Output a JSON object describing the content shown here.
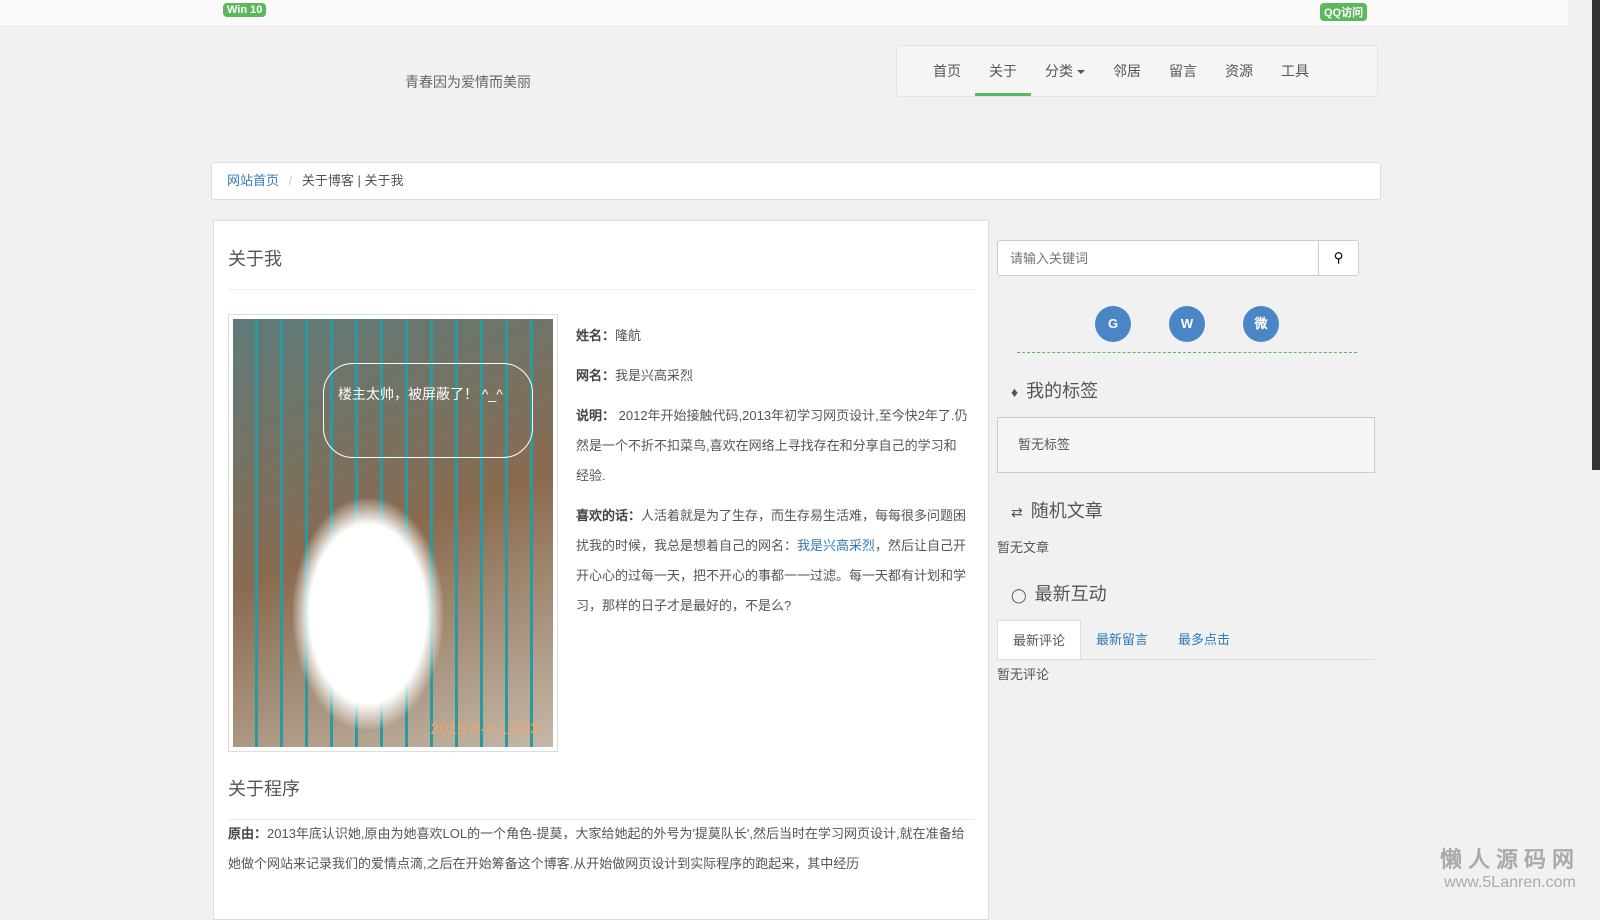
{
  "topbar": {
    "left_badge": "Win 10",
    "right_badge": "QQ访问"
  },
  "header": {
    "slogan": "青春因为爱情而美丽"
  },
  "nav": [
    {
      "label": "首页"
    },
    {
      "label": "关于"
    },
    {
      "label": "分类"
    },
    {
      "label": "邻居"
    },
    {
      "label": "留言"
    },
    {
      "label": "资源"
    },
    {
      "label": "工具"
    }
  ],
  "breadcrumb": {
    "home": "网站首页",
    "sep": "/",
    "current": "关于博客 | 关于我"
  },
  "main": {
    "title": "关于我",
    "photo": {
      "caption": "楼主太帅，被屏蔽了！ ^_^",
      "timestamp": "2015-5-4 10:03"
    },
    "name_label": "姓名：",
    "name": "隆航",
    "nick_label": "网名：",
    "nick": "我是兴高采烈",
    "desc_label": "说明：",
    "desc": " 2012年开始接触代码,2013年初学习网页设计,至今快2年了.仍然是一个不折不扣菜鸟,喜欢在网络上寻找存在和分享自己的学习和经验.",
    "quote_label": "喜欢的话：",
    "quote_a": "人活着就是为了生存，而生存易生活难，每每很多问题困扰我的时候，我总是想着自己的网名：",
    "quote_link": "我是兴高采烈",
    "quote_b": "，然后让自己开开心心的过每一天，把不开心的事都一一过滤。每一天都有计划和学习，那样的日子才是最好的，不是么?",
    "program_title": "关于程序",
    "reason_label": "原由：",
    "reason": "2013年底认识她,原由为她喜欢LOL的一个角色-提莫，大家给她起的外号为'提莫队长',然后当时在学习网页设计,就在准备给她做个网站来记录我们的爱情点滴,之后在开始筹备这个博客.从开始做网页设计到实际程序的跑起来，其中经历"
  },
  "sidebar": {
    "search_placeholder": "请输入关键词",
    "social": [
      {
        "icon": "github-icon",
        "glyph": "G"
      },
      {
        "icon": "wechat-icon",
        "glyph": "W"
      },
      {
        "icon": "weibo-icon",
        "glyph": "微"
      }
    ],
    "tags_title": "我的标签",
    "tags_empty": "暂无标签",
    "random_title": "随机文章",
    "random_empty": "暂无文章",
    "interact_title": "最新互动",
    "tabs": [
      {
        "label": "最新评论"
      },
      {
        "label": "最新留言"
      },
      {
        "label": "最多点击"
      }
    ],
    "comments_empty": "暂无评论"
  },
  "watermark": {
    "line1": "懒人源码网",
    "line2": "www.5Lanren.com"
  }
}
